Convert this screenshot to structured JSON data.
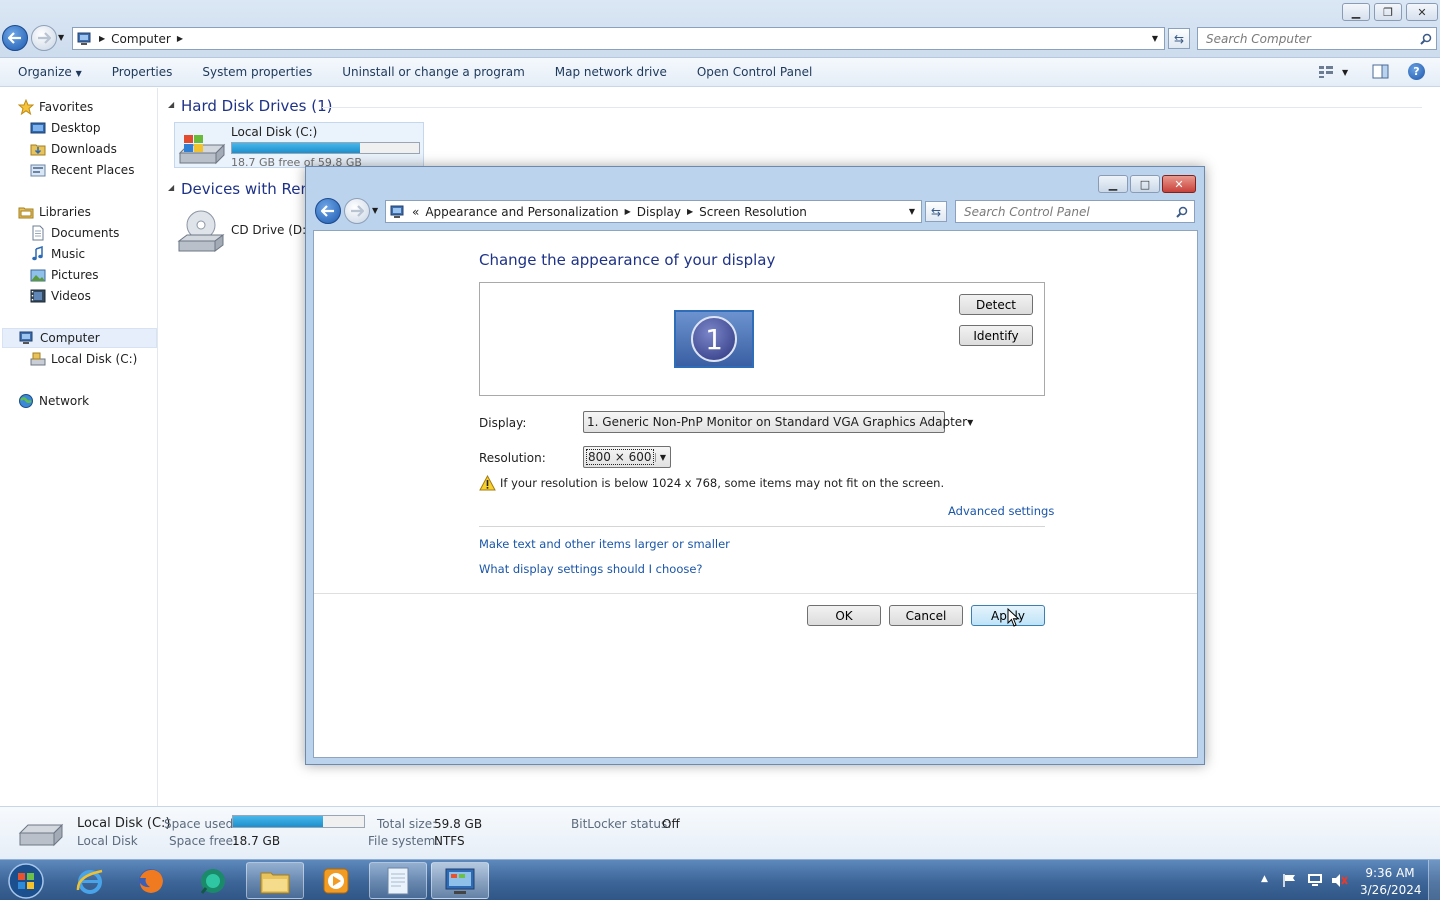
{
  "explorer": {
    "address": {
      "crumbs": [
        "Computer"
      ]
    },
    "search_placeholder": "Search Computer",
    "toolbar": [
      "Organize",
      "Properties",
      "System properties",
      "Uninstall or change a program",
      "Map network drive",
      "Open Control Panel"
    ],
    "sidebar": {
      "favorites": {
        "label": "Favorites",
        "items": [
          "Desktop",
          "Downloads",
          "Recent Places"
        ]
      },
      "libraries": {
        "label": "Libraries",
        "items": [
          "Documents",
          "Music",
          "Pictures",
          "Videos"
        ]
      },
      "computer": {
        "label": "Computer",
        "items": [
          "Local Disk (C:)"
        ]
      },
      "network": {
        "label": "Network"
      }
    },
    "groups": {
      "hard_disk": {
        "title": "Hard Disk Drives (1)",
        "drive": {
          "name": "Local Disk (C:)",
          "free_text": "18.7 GB free of 59.8 GB",
          "used_fraction": 0.687
        }
      },
      "removable": {
        "title": "Devices with Removable Storage",
        "drive": {
          "name": "CD Drive (D:)"
        }
      }
    },
    "status": {
      "name": "Local Disk (C:)",
      "type": "Local Disk",
      "space_used_label": "Space used:",
      "space_used_fraction": 0.687,
      "space_free_label": "Space free:",
      "space_free_value": "18.7 GB",
      "total_size_label": "Total size:",
      "total_size_value": "59.8 GB",
      "file_system_label": "File system:",
      "file_system_value": "NTFS",
      "bitlocker_label": "BitLocker status:",
      "bitlocker_value": "Off"
    }
  },
  "dialog": {
    "address": {
      "prefix": "«",
      "crumbs": [
        "Appearance and Personalization",
        "Display",
        "Screen Resolution"
      ]
    },
    "search_placeholder": "Search Control Panel",
    "heading": "Change the appearance of your display",
    "monitor_number": "1",
    "detect_label": "Detect",
    "identify_label": "Identify",
    "display_label": "Display:",
    "display_value": "1. Generic Non-PnP Monitor on Standard VGA Graphics Adapter",
    "resolution_label": "Resolution:",
    "resolution_value": "800 × 600",
    "warning_text": "If your resolution is below 1024 x 768, some items may not fit on the screen.",
    "advanced_link": "Advanced settings",
    "link1": "Make text and other items larger or smaller",
    "link2": "What display settings should I choose?",
    "ok_label": "OK",
    "cancel_label": "Cancel",
    "apply_label": "Apply"
  },
  "taskbar": {
    "clock_time": "9:36 AM",
    "clock_date": "3/26/2024",
    "apps": [
      "start-orb",
      "internet-explorer",
      "firefox",
      "app-globe",
      "file-explorer",
      "media-player",
      "notepad",
      "control-panel"
    ]
  },
  "colors": {
    "accent": "#1e3287",
    "link": "#1a56a8",
    "bar_fill": "#26a0da",
    "close_red": "#c8413b"
  }
}
